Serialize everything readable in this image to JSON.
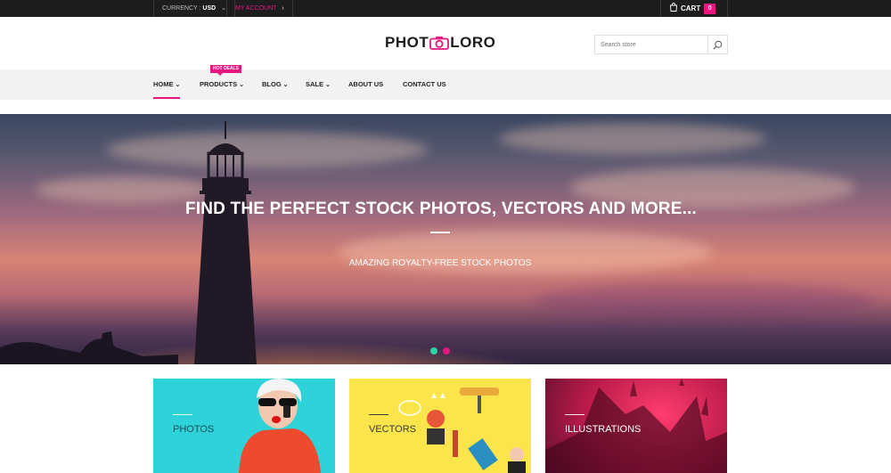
{
  "topbar": {
    "currency_label": "CURRENCY :",
    "currency_value": "USD",
    "account": "MY ACCOUNT",
    "cart_label": "CART",
    "cart_count": "0"
  },
  "header": {
    "logo_left": "PHOT",
    "logo_right": "LORO",
    "search_placeholder": "Search store"
  },
  "nav": {
    "badge": "HOT DEALS",
    "items": [
      {
        "label": "HOME",
        "dropdown": true,
        "active": true
      },
      {
        "label": "PRODUCTS",
        "dropdown": true
      },
      {
        "label": "BLOG",
        "dropdown": true
      },
      {
        "label": "SALE",
        "dropdown": true
      },
      {
        "label": "ABOUT US",
        "dropdown": false
      },
      {
        "label": "CONTACT US",
        "dropdown": false
      }
    ]
  },
  "hero": {
    "title": "FIND THE PERFECT STOCK PHOTOS, VECTORS AND MORE...",
    "subtitle": "AMAZING ROYALTY-FREE STOCK PHOTOS",
    "slides": 2,
    "active_slide": 1
  },
  "categories": [
    {
      "label": "PHOTOS",
      "color": "#2ed3d9"
    },
    {
      "label": "VECTORS",
      "color": "#fbe54a"
    },
    {
      "label": "ILLUSTRATIONS",
      "color": "#b81a4a"
    }
  ],
  "colors": {
    "accent": "#e6177e",
    "dot_active": "#2ed3a3",
    "topbar": "#1d1d1d",
    "nav_bg": "#f2f2f2"
  }
}
